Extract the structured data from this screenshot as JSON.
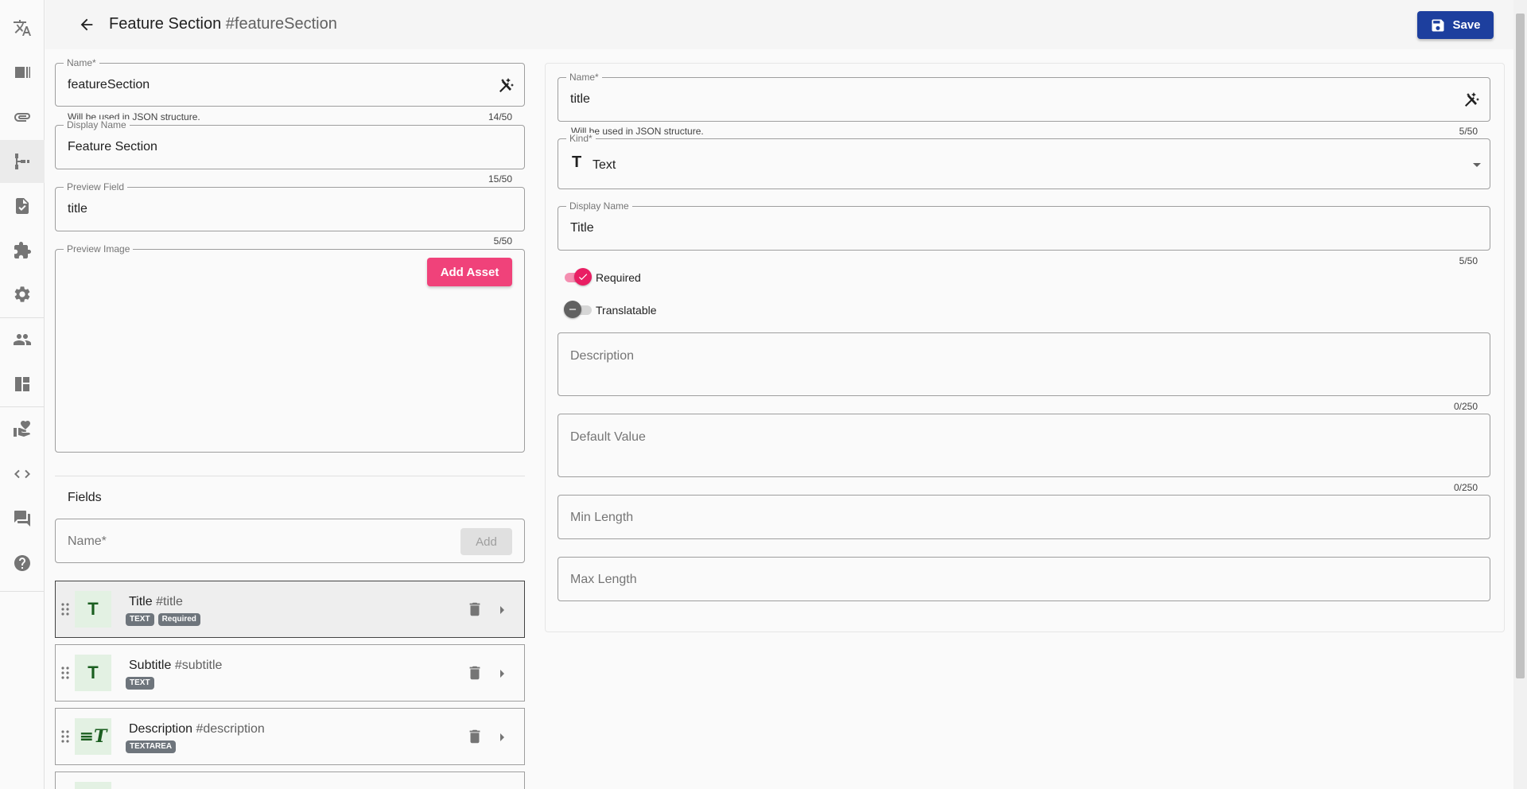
{
  "icons": {
    "sidebar": [
      "translate-icon",
      "view-column-icon",
      "attachment-icon",
      "schema-icon",
      "assignment-check-icon",
      "extension-icon",
      "settings-gear-icon",
      "people-icon",
      "dashboard-icon",
      "volunteer-hand-heart-icon",
      "code-brackets-icon",
      "forum-chat-icon",
      "help-circle-icon"
    ],
    "header": [
      "arrow-back-icon",
      "floppy-save-icon"
    ],
    "fields": [
      "auto-fix-wand-icon",
      "drag-handle-icon",
      "trash-delete-icon",
      "caret-right-icon",
      "dropdown-arrow-icon",
      "check-icon",
      "minus-icon"
    ]
  },
  "colors": {
    "primary": "#1d3f9e",
    "accent": "#f0427a",
    "badge": "#6e757c",
    "type_box_bg": "#e3f1e3"
  },
  "header": {
    "title": "Feature Section",
    "hash": "#featureSection",
    "save_label": "Save"
  },
  "component": {
    "name": {
      "label": "Name*",
      "value": "featureSection",
      "hint": "Will be used in JSON structure.",
      "counter": "14/50"
    },
    "display_name": {
      "label": "Display Name",
      "value": "Feature Section",
      "counter": "15/50"
    },
    "preview_field": {
      "label": "Preview Field",
      "value": "title",
      "counter": "5/50"
    },
    "preview_image": {
      "label": "Preview Image",
      "button": "Add Asset"
    }
  },
  "fields_section": {
    "heading": "Fields",
    "name_placeholder": "Name*",
    "add_label": "Add",
    "items": [
      {
        "icon": "T",
        "title": "Title",
        "hash": "#title",
        "badges": [
          "TEXT",
          "Required"
        ]
      },
      {
        "icon": "T",
        "title": "Subtitle",
        "hash": "#subtitle",
        "badges": [
          "TEXT"
        ]
      },
      {
        "icon": "≡T",
        "title": "Description",
        "hash": "#description",
        "badges": [
          "TEXTAREA"
        ]
      }
    ]
  },
  "field_detail": {
    "name": {
      "label": "Name*",
      "value": "title",
      "hint": "Will be used in JSON structure.",
      "counter": "5/50"
    },
    "kind": {
      "label": "Kind*",
      "icon": "T",
      "value": "Text"
    },
    "display_name": {
      "label": "Display Name",
      "value": "Title",
      "counter": "5/50"
    },
    "required": {
      "label": "Required",
      "on": true
    },
    "translatable": {
      "label": "Translatable",
      "on": false
    },
    "description": {
      "placeholder": "Description",
      "counter": "0/250"
    },
    "default_value": {
      "placeholder": "Default Value",
      "counter": "0/250"
    },
    "min_length": {
      "placeholder": "Min Length"
    },
    "max_length": {
      "placeholder": "Max Length"
    }
  }
}
